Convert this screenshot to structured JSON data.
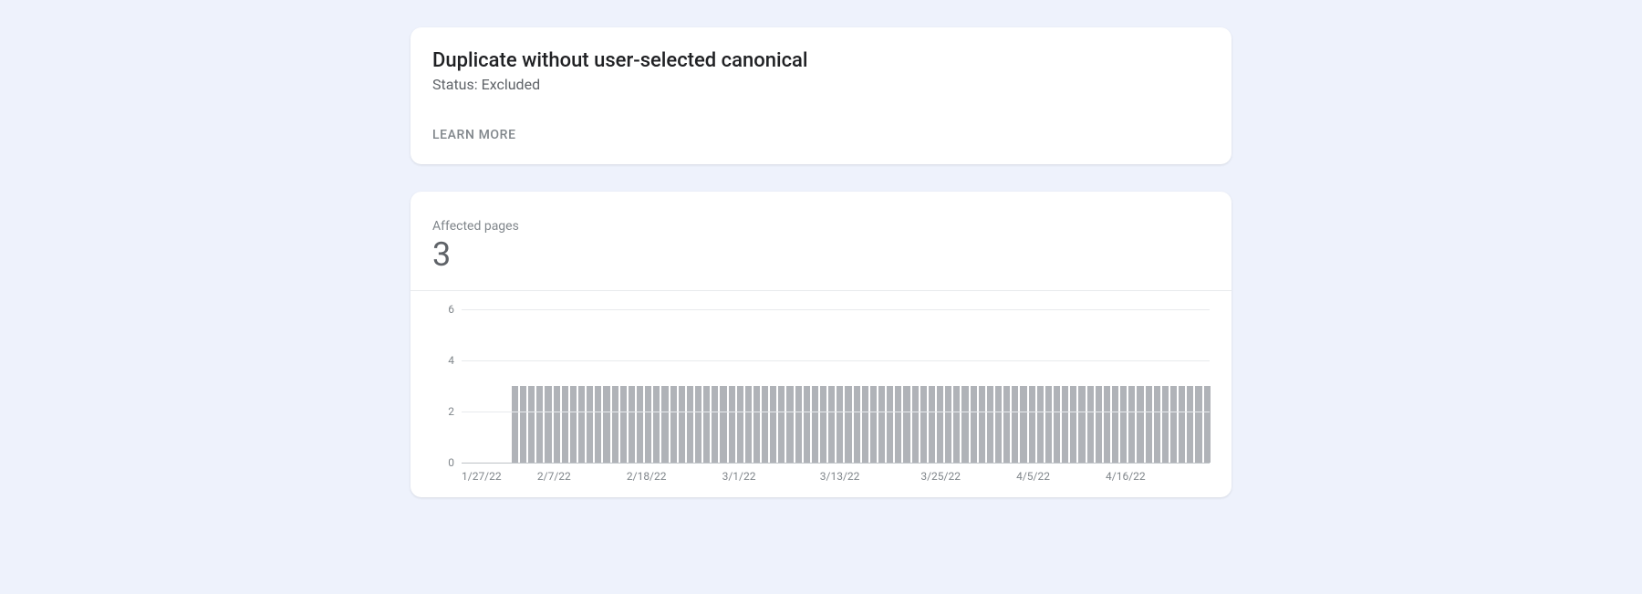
{
  "header": {
    "title": "Duplicate without user-selected canonical",
    "status": "Status: Excluded",
    "learn_more": "LEARN MORE"
  },
  "metric": {
    "label": "Affected pages",
    "value": "3"
  },
  "chart_data": {
    "type": "bar",
    "title": "",
    "xlabel": "",
    "ylabel": "",
    "ylim": [
      0,
      6
    ],
    "yticks": [
      0,
      2,
      4,
      6
    ],
    "x_tick_labels": [
      "1/27/22",
      "2/7/22",
      "2/18/22",
      "3/1/22",
      "3/13/22",
      "3/25/22",
      "4/5/22",
      "4/16/22"
    ],
    "categories": [
      "1/27/22",
      "1/28/22",
      "1/29/22",
      "1/30/22",
      "1/31/22",
      "2/1/22",
      "2/2/22",
      "2/3/22",
      "2/4/22",
      "2/5/22",
      "2/6/22",
      "2/7/22",
      "2/8/22",
      "2/9/22",
      "2/10/22",
      "2/11/22",
      "2/12/22",
      "2/13/22",
      "2/14/22",
      "2/15/22",
      "2/16/22",
      "2/17/22",
      "2/18/22",
      "2/19/22",
      "2/20/22",
      "2/21/22",
      "2/22/22",
      "2/23/22",
      "2/24/22",
      "2/25/22",
      "2/26/22",
      "2/27/22",
      "2/28/22",
      "3/1/22",
      "3/2/22",
      "3/3/22",
      "3/4/22",
      "3/5/22",
      "3/6/22",
      "3/7/22",
      "3/8/22",
      "3/9/22",
      "3/10/22",
      "3/11/22",
      "3/12/22",
      "3/13/22",
      "3/14/22",
      "3/15/22",
      "3/16/22",
      "3/17/22",
      "3/18/22",
      "3/19/22",
      "3/20/22",
      "3/21/22",
      "3/22/22",
      "3/23/22",
      "3/24/22",
      "3/25/22",
      "3/26/22",
      "3/27/22",
      "3/28/22",
      "3/29/22",
      "3/30/22",
      "3/31/22",
      "4/1/22",
      "4/2/22",
      "4/3/22",
      "4/4/22",
      "4/5/22",
      "4/6/22",
      "4/7/22",
      "4/8/22",
      "4/9/22",
      "4/10/22",
      "4/11/22",
      "4/12/22",
      "4/13/22",
      "4/14/22",
      "4/15/22",
      "4/16/22",
      "4/17/22",
      "4/18/22",
      "4/19/22",
      "4/20/22",
      "4/21/22",
      "4/22/22",
      "4/23/22",
      "4/24/22",
      "4/25/22",
      "4/26/22"
    ],
    "values": [
      0,
      0,
      0,
      0,
      0,
      0,
      3,
      3,
      3,
      3,
      3,
      3,
      3,
      3,
      3,
      3,
      3,
      3,
      3,
      3,
      3,
      3,
      3,
      3,
      3,
      3,
      3,
      3,
      3,
      3,
      3,
      3,
      3,
      3,
      3,
      3,
      3,
      3,
      3,
      3,
      3,
      3,
      3,
      3,
      3,
      3,
      3,
      3,
      3,
      3,
      3,
      3,
      3,
      3,
      3,
      3,
      3,
      3,
      3,
      3,
      3,
      3,
      3,
      3,
      3,
      3,
      3,
      3,
      3,
      3,
      3,
      3,
      3,
      3,
      3,
      3,
      3,
      3,
      3,
      3,
      3,
      3,
      3,
      3,
      3,
      3,
      3,
      3,
      3,
      3
    ]
  }
}
